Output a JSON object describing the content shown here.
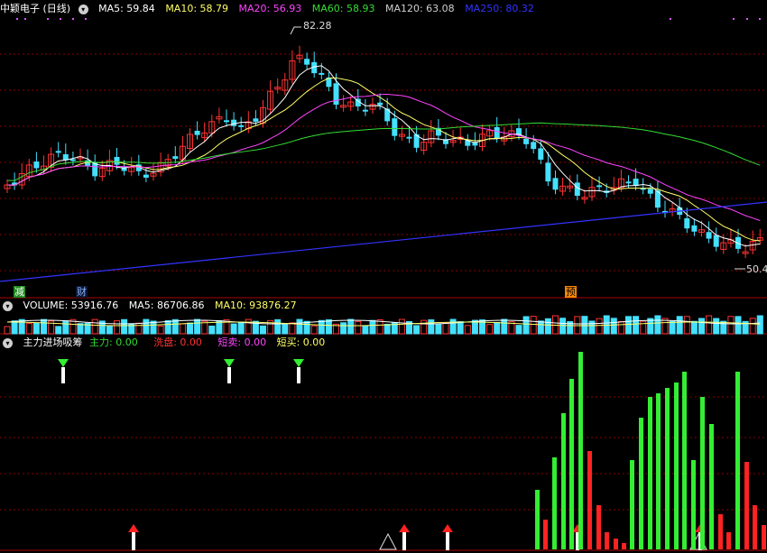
{
  "header_main": {
    "title": "中颖电子 (日线)",
    "items": [
      {
        "label": "MA5: 59.84",
        "color": "#ffffff"
      },
      {
        "label": "MA10: 58.79",
        "color": "#ffff66"
      },
      {
        "label": "MA20: 56.93",
        "color": "#ff44ff"
      },
      {
        "label": "MA60: 58.93",
        "color": "#33dd33"
      },
      {
        "label": "MA120: 63.08",
        "color": "#cfcfcf"
      },
      {
        "label": "MA250: 80.32",
        "color": "#3333ff"
      }
    ]
  },
  "price_labels": {
    "high": "82.28",
    "low": "50.4"
  },
  "markers": [
    {
      "label": "减",
      "bg": "#1e8a1e",
      "fg": "#ffffff"
    },
    {
      "label": "财",
      "bg": "#111133",
      "fg": "#7fb4ff"
    },
    {
      "label": "预",
      "bg": "#ff8800",
      "fg": "#000000"
    }
  ],
  "header_volume": {
    "items": [
      {
        "label": "VOLUME: 53916.76",
        "color": "#ffffff"
      },
      {
        "label": "MA5: 86706.86",
        "color": "#ffffff"
      },
      {
        "label": "MA10: 93876.27",
        "color": "#ffff66"
      }
    ]
  },
  "header_indicator": {
    "name": "主力进场吸筹",
    "items": [
      {
        "label": "主力: 0.00",
        "color": "#33dd33"
      },
      {
        "label": "洗盘: 0.00",
        "color": "#ff3333"
      },
      {
        "label": "短卖: 0.00",
        "color": "#ff44ff"
      },
      {
        "label": "短买: 0.00",
        "color": "#ffff66"
      }
    ]
  },
  "colors": {
    "up": "#ff3333",
    "down": "#44e0ff",
    "grid": "#8b0000",
    "ma5": "#ffffff",
    "ma10": "#ffff66",
    "ma20": "#ff44ff",
    "ma60": "#33dd33",
    "ma250": "#3333ff",
    "green": "#33ee33",
    "red": "#ff2222"
  },
  "icons": {
    "header_toggle": "chevron-down-icon"
  }
}
